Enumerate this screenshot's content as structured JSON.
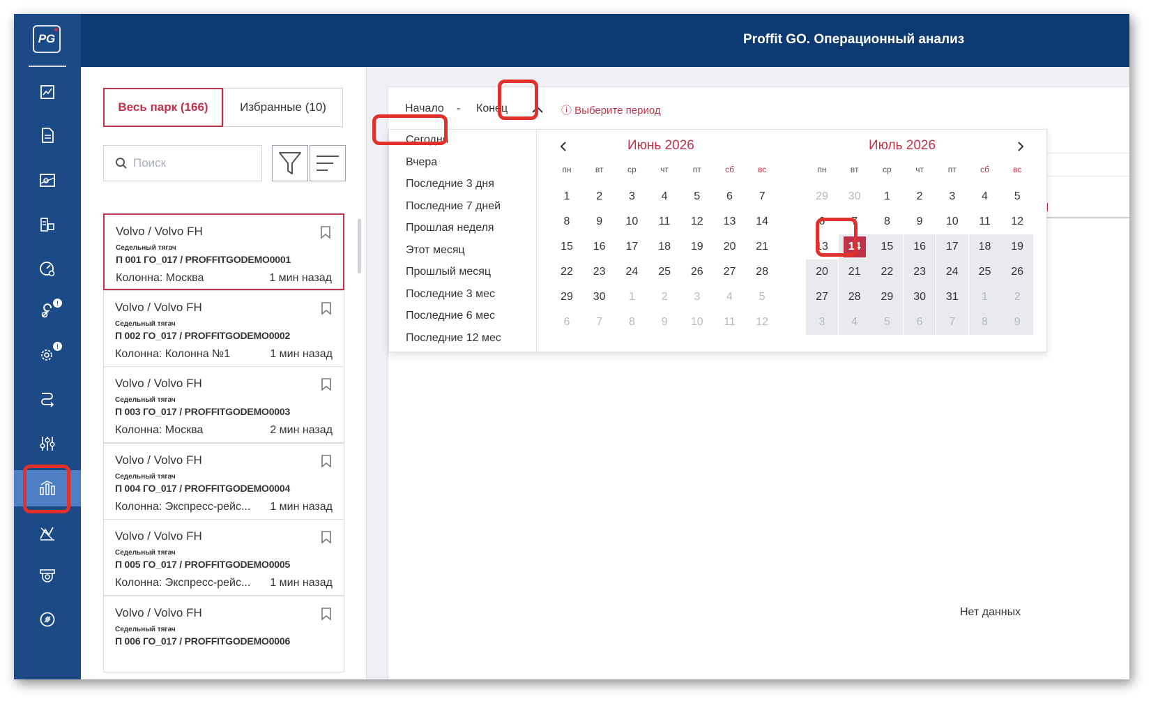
{
  "app": {
    "logo": "PG",
    "title": "Proffit GO. Операционный анализ"
  },
  "sidebar": {
    "items": [
      {
        "icon": "chart-report-icon"
      },
      {
        "icon": "document-icon"
      },
      {
        "icon": "map-icon"
      },
      {
        "icon": "truck-list-icon"
      },
      {
        "icon": "speed-settings-icon"
      },
      {
        "icon": "wrench-alert-icon",
        "badge": "!"
      },
      {
        "icon": "gear-alert-icon",
        "badge": "!"
      },
      {
        "icon": "route-icon"
      },
      {
        "icon": "sliders-icon"
      },
      {
        "icon": "analytics-icon",
        "active": true
      },
      {
        "icon": "diagnostics-icon"
      },
      {
        "icon": "camera-icon"
      },
      {
        "icon": "fuel-icon"
      }
    ]
  },
  "fleet": {
    "tabs": {
      "all": "Весь парк (166)",
      "favorites": "Избранные (10)"
    },
    "search_placeholder": "Поиск",
    "vehicles": [
      {
        "model": "Volvo / Volvo FH",
        "kind": "Седельный тягач",
        "plate": "П 001 ГО_017 / PROFFITGODEMO0001",
        "column": "Колонна: Москва",
        "time": "1 мин назад",
        "selected": true
      },
      {
        "model": "Volvo / Volvo FH",
        "kind": "Седельный тягач",
        "plate": "П 002 ГО_017 / PROFFITGODEMO0002",
        "column": "Колонна: Колонна №1",
        "time": "1 мин назад"
      },
      {
        "model": "Volvo / Volvo FH",
        "kind": "Седельный тягач",
        "plate": "П 003 ГО_017 / PROFFITGODEMO0003",
        "column": "Колонна: Москва",
        "time": "2 мин назад"
      },
      {
        "model": "Volvo / Volvo FH",
        "kind": "Седельный тягач",
        "plate": "П 004 ГО_017 / PROFFITGODEMO0004",
        "column": "Колонна: Экспресс-рейс...",
        "time": "1 мин назад"
      },
      {
        "model": "Volvo / Volvo FH",
        "kind": "Седельный тягач",
        "plate": "П 005 ГО_017 / PROFFITGODEMO0005",
        "column": "Колонна: Экспресс-рейс...",
        "time": "1 мин назад"
      },
      {
        "model": "Volvo / Volvo FH",
        "kind": "Седельный тягач",
        "plate": "П 006 ГО_017 / PROFFITGODEMO0006",
        "column": "",
        "time": ""
      }
    ]
  },
  "period": {
    "start": "Начало",
    "separator": "-",
    "end": "Конец",
    "hint": "ⓘ Выберите период",
    "presets": [
      "Сегодня",
      "Вчера",
      "Последние 3 дня",
      "Последние 7 дней",
      "Прошлая неделя",
      "Этот месяц",
      "Прошлый месяц",
      "Последние 3 мес",
      "Последние 6 мес",
      "Последние 12 мес"
    ],
    "weekdays": [
      "пн",
      "вт",
      "ср",
      "чт",
      "пт",
      "сб",
      "вс"
    ],
    "months": [
      {
        "title": "Июнь 2026",
        "weeks": [
          [
            "1",
            "2",
            "3",
            "4",
            "5",
            "6",
            "7"
          ],
          [
            "8",
            "9",
            "10",
            "11",
            "12",
            "13",
            "14"
          ],
          [
            "15",
            "16",
            "17",
            "18",
            "19",
            "20",
            "21"
          ],
          [
            "22",
            "23",
            "24",
            "25",
            "26",
            "27",
            "28"
          ],
          [
            "29",
            "30",
            "1",
            "2",
            "3",
            "4",
            "5"
          ],
          [
            "6",
            "7",
            "8",
            "9",
            "10",
            "11",
            "12"
          ]
        ],
        "lead_muted": 0,
        "trail_muted_from": 30
      },
      {
        "title": "Июль 2026",
        "weeks": [
          [
            "29",
            "30",
            "1",
            "2",
            "3",
            "4",
            "5"
          ],
          [
            "6",
            "7",
            "8",
            "9",
            "10",
            "11",
            "12"
          ],
          [
            "13",
            "14",
            "15",
            "16",
            "17",
            "18",
            "19"
          ],
          [
            "20",
            "21",
            "22",
            "23",
            "24",
            "25",
            "26"
          ],
          [
            "27",
            "28",
            "29",
            "30",
            "31",
            "1",
            "2"
          ],
          [
            "3",
            "4",
            "5",
            "6",
            "7",
            "8",
            "9"
          ]
        ],
        "lead_muted": 2,
        "trail_muted_from": 33,
        "today": "14"
      }
    ]
  },
  "main": {
    "no_data": "Нет данных"
  },
  "colors": {
    "accent": "#c0324a",
    "sidebar": "#1c4a86",
    "header": "#0d3a73",
    "highlight": "#e2302b"
  }
}
